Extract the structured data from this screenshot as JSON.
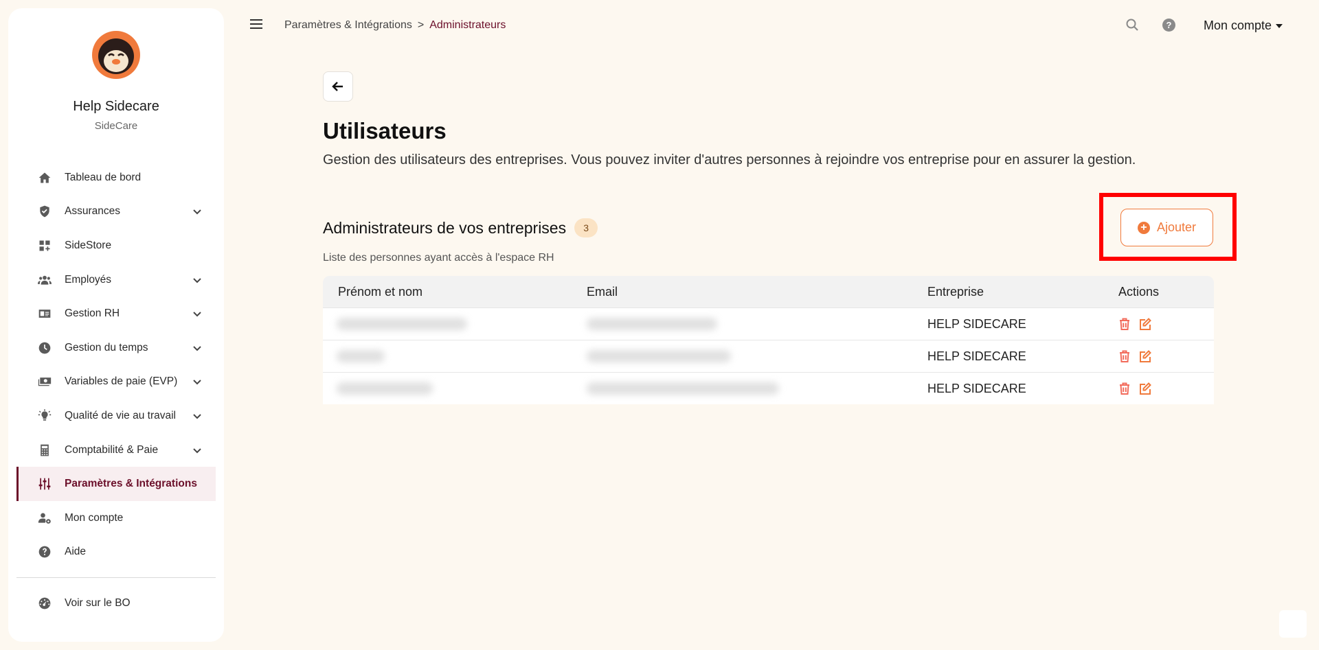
{
  "sidebar": {
    "org_name": "Help Sidecare",
    "org_sub": "SideCare",
    "items": [
      {
        "label": "Tableau de bord",
        "icon": "home-icon",
        "chevron": false
      },
      {
        "label": "Assurances",
        "icon": "shield-icon",
        "chevron": true
      },
      {
        "label": "SideStore",
        "icon": "grid-plus-icon",
        "chevron": false
      },
      {
        "label": "Employés",
        "icon": "users-icon",
        "chevron": true
      },
      {
        "label": "Gestion RH",
        "icon": "id-card-icon",
        "chevron": true
      },
      {
        "label": "Gestion du temps",
        "icon": "clock-icon",
        "chevron": true
      },
      {
        "label": "Variables de paie (EVP)",
        "icon": "money-icon",
        "chevron": true
      },
      {
        "label": "Qualité de vie au travail",
        "icon": "lightbulb-icon",
        "chevron": true
      },
      {
        "label": "Comptabilité & Paie",
        "icon": "calculator-icon",
        "chevron": true
      },
      {
        "label": "Paramètres & Intégrations",
        "icon": "sliders-icon",
        "chevron": false,
        "active": true
      },
      {
        "label": "Mon compte",
        "icon": "user-gear-icon",
        "chevron": false
      },
      {
        "label": "Aide",
        "icon": "help-circle-icon",
        "chevron": false
      }
    ],
    "bo_label": "Voir sur le BO"
  },
  "header": {
    "breadcrumb_parent": "Paramètres & Intégrations",
    "breadcrumb_sep": ">",
    "breadcrumb_current": "Administrateurs",
    "help_glyph": "?",
    "account_label": "Mon compte"
  },
  "main": {
    "title": "Utilisateurs",
    "description": "Gestion des utilisateurs des entreprises. Vous pouvez inviter d'autres personnes à rejoindre vos entreprise pour en assurer la gestion.",
    "section_title": "Administrateurs de vos entreprises",
    "section_count": "3",
    "section_subtitle": "Liste des personnes ayant accès à l'espace RH",
    "add_label": "Ajouter",
    "add_glyph": "+",
    "table": {
      "headers": [
        "Prénom et nom",
        "Email",
        "Entreprise",
        "Actions"
      ],
      "rows": [
        {
          "company": "HELP SIDECARE"
        },
        {
          "company": "HELP SIDECARE"
        },
        {
          "company": "HELP SIDECARE"
        }
      ]
    }
  },
  "colors": {
    "accent": "#f07a3c",
    "brand": "#6b0f2a",
    "highlight": "#ff0000",
    "background": "#fdf8f0"
  }
}
